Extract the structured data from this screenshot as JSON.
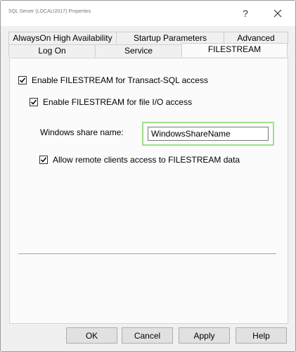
{
  "window": {
    "title": "SQL Server (LOCALI2017) Properties"
  },
  "titlebar": {
    "help_glyph": "?",
    "close_icon": "close-icon"
  },
  "tabs": {
    "row_back": [
      "AlwaysOn High Availability",
      "Startup Parameters",
      "Advanced"
    ],
    "row_front": [
      "Log On",
      "Service",
      "FILESTREAM"
    ],
    "active": "FILESTREAM"
  },
  "filestream": {
    "enable_tsql": {
      "label": "Enable FILESTREAM for Transact-SQL access",
      "checked": true
    },
    "enable_file_io": {
      "label": "Enable FILESTREAM for file I/O access",
      "checked": true
    },
    "share_name_label": "Windows share name:",
    "share_name_value": "WindowsShareName",
    "allow_remote": {
      "label": "Allow remote clients access to FILESTREAM data",
      "checked": true
    }
  },
  "buttons": {
    "ok": "OK",
    "cancel": "Cancel",
    "apply": "Apply",
    "help": "Help"
  },
  "colors": {
    "highlight_border": "#9fe08c"
  }
}
